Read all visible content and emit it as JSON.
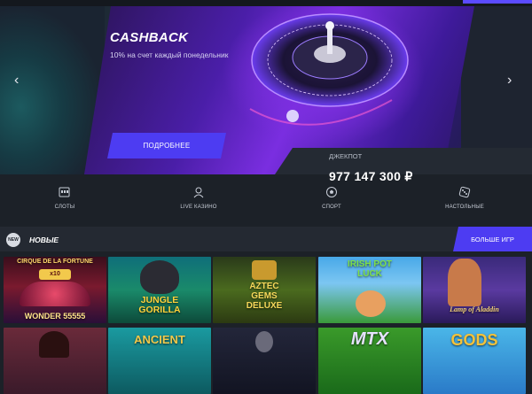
{
  "hero": {
    "title": "CASHBACK",
    "subtitle": "10% на счет каждый понедельник",
    "more_button": "ПОДРОБНЕЕ",
    "jackpot_label": "ДЖЕКПОТ",
    "jackpot_value": "977 147 300 ₽",
    "prev_arrow": "‹",
    "next_arrow": "›"
  },
  "categories": [
    {
      "label": "СЛОТЫ",
      "icon": "slot-machine-icon"
    },
    {
      "label": "LIVE КАЗИНО",
      "icon": "live-dealer-icon"
    },
    {
      "label": "СПОРТ",
      "icon": "soccer-ball-icon"
    },
    {
      "label": "НАСТОЛЬНЫЕ",
      "icon": "dice-icon"
    }
  ],
  "new_games": {
    "icon_text": "NEW",
    "title": "НОВЫЕ",
    "more_button": "БОЛЬШЕ ИГР",
    "row1": [
      {
        "title": "CIRQUE DE LA FORTUNE",
        "badge": "x10",
        "footer": "WONDER 55555"
      },
      {
        "title": "JUNGLE GORILLA"
      },
      {
        "title": "AZTEC GEMS DELUXE"
      },
      {
        "title": "IRISH POT LUCK"
      },
      {
        "title": "Lamp of Aladdin"
      }
    ],
    "row2": [
      {
        "title": ""
      },
      {
        "title": "ANCIENT"
      },
      {
        "title": ""
      },
      {
        "title": "MTX"
      },
      {
        "title": "GODS"
      }
    ]
  },
  "colors": {
    "accent": "#4d3cf2",
    "background": "#1c2128",
    "bar": "#242932"
  }
}
